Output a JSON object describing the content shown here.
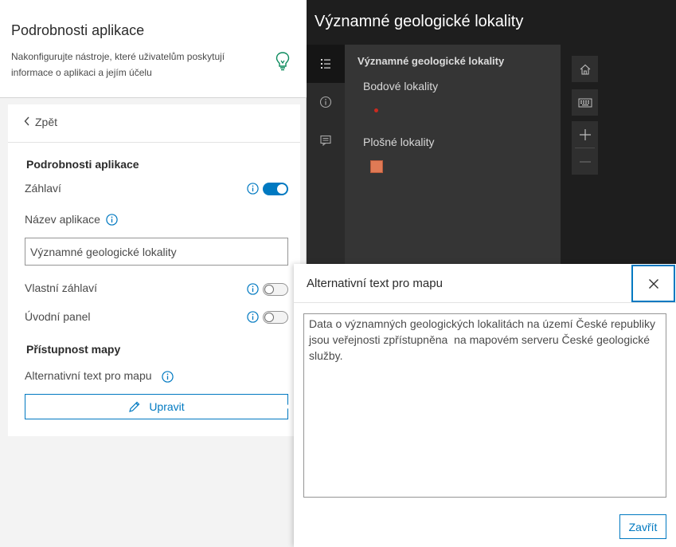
{
  "settings": {
    "title": "Podrobnosti aplikace",
    "description": "Nakonfigurujte nástroje, které uživatelům poskytují informace o aplikaci a jejím účelu",
    "back_label": "Zpět",
    "section_details": "Podrobnosti aplikace",
    "header_label": "Záhlaví",
    "header_on": true,
    "app_name_label": "Název aplikace",
    "app_name_value": "Významné geologické lokality",
    "custom_header_label": "Vlastní záhlaví",
    "custom_header_on": false,
    "intro_panel_label": "Úvodní panel",
    "intro_panel_on": false,
    "section_accessibility": "Přístupnost mapy",
    "alt_text_label": "Alternativní text pro mapu",
    "edit_label": "Upravit"
  },
  "preview": {
    "app_title": "Významné geologické lokality",
    "legend_title": "Významné geologické lokality",
    "legend_items": [
      {
        "label": "Bodové lokality",
        "symbol": "point",
        "color": "#cc2a1f"
      },
      {
        "label": "Plošné lokality",
        "symbol": "polygon",
        "color": "#e07a55"
      }
    ],
    "rail_icons": [
      "legend-icon",
      "info-icon",
      "comment-icon"
    ],
    "controls": [
      "home-icon",
      "keyboard-icon",
      "zoom-in-icon",
      "zoom-out-icon"
    ]
  },
  "dialog": {
    "title": "Alternativní text pro mapu",
    "text": "Data o významných geologických lokalitách na území České republiky jsou veřejnosti zpřístupněna  na mapovém serveru České geologické služby.",
    "close_label": "Zavřít"
  },
  "colors": {
    "accent": "#0079c1",
    "map_bg": "#1e1e1e",
    "legend_bg": "#353535"
  }
}
